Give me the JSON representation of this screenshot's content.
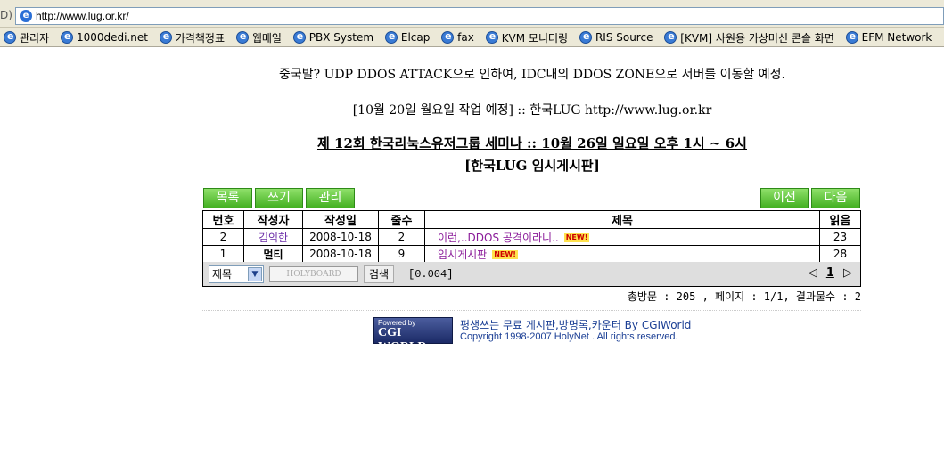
{
  "browser": {
    "address_label": "D)",
    "url": "http://www.lug.or.kr/",
    "links": [
      {
        "label": "관리자"
      },
      {
        "label": "1000dedi.net"
      },
      {
        "label": "가격책정표"
      },
      {
        "label": "웹메일"
      },
      {
        "label": "PBX System"
      },
      {
        "label": "Elcap"
      },
      {
        "label": "fax"
      },
      {
        "label": "KVM 모니터링"
      },
      {
        "label": "RIS Source"
      },
      {
        "label": "[KVM] 사원용 가상머신 콘솔 화면"
      },
      {
        "label": "EFM Network"
      }
    ]
  },
  "notice": {
    "line1": "중국발? UDP DDOS ATTACK으로 인하여, IDC내의 DDOS ZONE으로 서버를 이동할 예정.",
    "line2": "[10월 20일 월요일 작업 예정] :: 한국LUG http://www.lug.or.kr",
    "line3": "제 12회 한국리눅스유저그룹 세미나 :: 10월 26일 일요일 오후 1시 ~ 6시",
    "line4": "[한국LUG 임시게시판]"
  },
  "buttons": {
    "list": "목록",
    "write": "쓰기",
    "admin": "관리",
    "prev": "이전",
    "next": "다음"
  },
  "table": {
    "headers": {
      "no": "번호",
      "writer": "작성자",
      "date": "작성일",
      "replies": "줄수",
      "title": "제목",
      "reads": "읽음"
    },
    "rows": [
      {
        "no": "2",
        "writer": "김익한",
        "date": "2008-10-18",
        "replies": "2",
        "title": "이런,..DDOS 공격이라니..",
        "badge": "NEW!",
        "reads": "23"
      },
      {
        "no": "1",
        "writer": "멀티",
        "date": "2008-10-18",
        "replies": "9",
        "title": "임시게시판",
        "badge": "NEW!",
        "reads": "28"
      }
    ]
  },
  "search": {
    "field_select": "제목",
    "input_brand": "HOLYBOARD",
    "button": "검색",
    "elapsed": "[0.004]",
    "pager_prev": "◁",
    "pager_current": "1",
    "pager_next": "▷"
  },
  "stats": "총방문 : 205 , 페이지 : 1/1, 결과물수 : 2",
  "footer": {
    "logo_small": "Powered by",
    "logo_big": "CGI WORLD",
    "line1": "평생쓰는 무료 게시판,방명록,카운터 By CGIWorld",
    "line2": "Copyright 1998-2007 HolyNet . All rights reserved."
  },
  "colors": {
    "button_green": "#43b021",
    "writer_link": "#6b2da8",
    "title_link": "#8b1c9a",
    "footer_text": "#1a3e94"
  }
}
